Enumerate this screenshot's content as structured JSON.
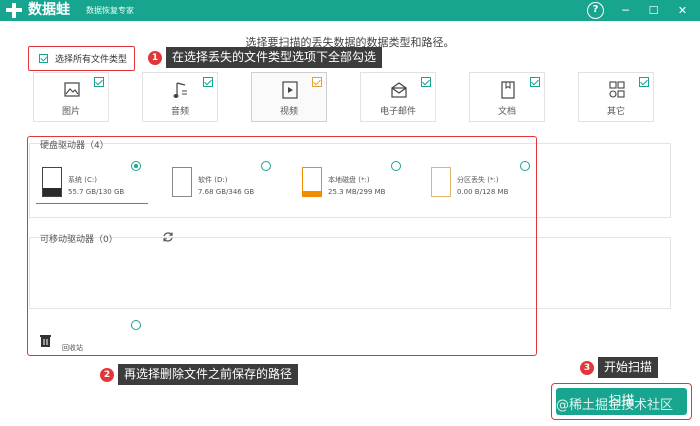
{
  "app": {
    "name": "数据蛙",
    "subtitle": "数据恢复专家"
  },
  "window": {
    "help": "?",
    "minimize": "─",
    "maximize": "☐",
    "close": "✕"
  },
  "instruction": "选择要扫描的丢失数据的数据类型和路径。",
  "select_all": {
    "label": "选择所有文件类型",
    "checked": true
  },
  "file_types": [
    {
      "label": "图片",
      "icon": "image-icon",
      "checked": true
    },
    {
      "label": "音频",
      "icon": "music-icon",
      "checked": true
    },
    {
      "label": "视频",
      "icon": "video-icon",
      "checked": true
    },
    {
      "label": "电子邮件",
      "icon": "mail-icon",
      "checked": true
    },
    {
      "label": "文档",
      "icon": "document-icon",
      "checked": true
    },
    {
      "label": "其它",
      "icon": "other-icon",
      "checked": true
    }
  ],
  "callouts": {
    "one": {
      "number": "1",
      "text": "在选择丢失的文件类型选项下全部勾选"
    },
    "two": {
      "number": "2",
      "text": "再选择删除文件之前保存的路径"
    },
    "three": {
      "number": "3",
      "text": "开始扫描"
    }
  },
  "hard_drives": {
    "title": "硬盘驱动器（4）",
    "drives": [
      {
        "name": "系统 (C:)",
        "size": "55.7 GB/130 GB",
        "selected": true
      },
      {
        "name": "软件 (D:)",
        "size": "7.68 GB/346 GB",
        "selected": false
      },
      {
        "name": "本地磁盘 (*:)",
        "size": "25.3 MB/299 MB",
        "selected": false
      },
      {
        "name": "分区丢失 (*:)",
        "size": "0.00  B/128 MB",
        "selected": false
      }
    ]
  },
  "removable": {
    "title": "可移动驱动器（0）"
  },
  "recycle_bin": {
    "label": "回收站"
  },
  "scan_button": {
    "label": "扫描"
  },
  "watermark": "@稀土掘金技术社区",
  "colors": {
    "accent": "#18a58f",
    "highlight": "#e0383a",
    "callout_bg": "#3c3c3c"
  }
}
